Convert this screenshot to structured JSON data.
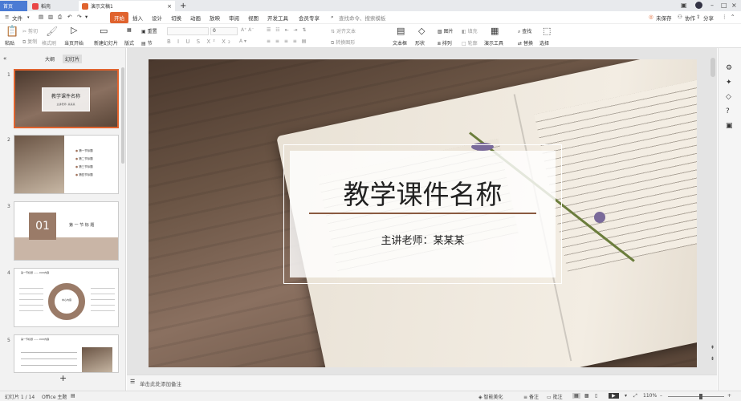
{
  "tabs": {
    "home": "首页",
    "app2": "稻壳",
    "doc": "演示文稿1",
    "add": "+"
  },
  "menu": {
    "file": "文件",
    "start": "开始",
    "insert": "插入",
    "design": "设计",
    "transition": "切换",
    "animation": "动画",
    "slideshow": "放映",
    "review": "审阅",
    "view": "视图",
    "devtools": "开发工具",
    "member": "会员专享",
    "search": "查找命令、搜索模板",
    "unsaved": "未保存",
    "collab": "协作",
    "share": "分享"
  },
  "ribbon": {
    "paste": "粘贴",
    "cut": "剪切",
    "copy": "复制",
    "format_painter": "格式刷",
    "play": "当页开始",
    "new_slide": "新建幻灯片",
    "layout": "版式",
    "section": "节",
    "reset": "重置",
    "font_size": "0",
    "convert": "转换图形",
    "textbox": "文本框",
    "shape": "形状",
    "arrange": "排列",
    "picture": "图片",
    "fill": "填充",
    "outline": "轮廓",
    "present_tool": "演示工具",
    "find": "查找",
    "replace": "替换",
    "select": "选择",
    "text_direction": "对齐文本"
  },
  "panel": {
    "outline_tab": "大纲",
    "slides_tab": "幻灯片",
    "add": "+"
  },
  "thumbs": [
    {
      "num": "1",
      "title": "教学课件名称",
      "sub": "主讲老师: 某某某"
    },
    {
      "num": "2",
      "items": [
        "第一节标题",
        "第二节标题",
        "第三节标题",
        "第四节标题"
      ]
    },
    {
      "num": "3",
      "big": "01",
      "title": "第 一 节 标 题"
    },
    {
      "num": "4",
      "title": "第一节标题 —— XXX内容",
      "center": "中心内容"
    },
    {
      "num": "5",
      "title": "第一节标题 —— XXX内容"
    }
  ],
  "slide": {
    "title": "教学课件名称",
    "subtitle": "主讲老师：某某某"
  },
  "notes": {
    "placeholder": "单击此处添加备注"
  },
  "status": {
    "page": "幻灯片 1 / 14",
    "theme": "Office 主题",
    "smart": "智能美化",
    "notes": "备注",
    "comments": "批注",
    "zoom": "110%"
  },
  "colors": {
    "accent": "#e0632e",
    "slide_rule": "#8a5a40"
  }
}
